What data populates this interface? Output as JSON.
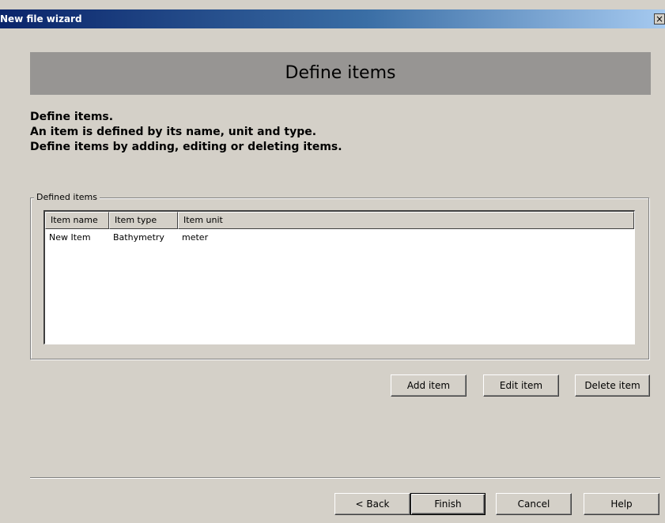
{
  "window": {
    "title": "New file wizard",
    "close_glyph": "×"
  },
  "header": {
    "title": "Define items"
  },
  "description": {
    "line1": "Define items.",
    "line2": "An item is defined by its name, unit and type.",
    "line3": "Define items by adding, editing or deleting items."
  },
  "group": {
    "label": "Defined items"
  },
  "table": {
    "columns": [
      "Item name",
      "Item type",
      "Item unit"
    ],
    "rows": [
      [
        "New Item",
        "Bathymetry",
        "meter"
      ]
    ]
  },
  "item_buttons": {
    "add": "Add item",
    "edit": "Edit item",
    "delete": "Delete item"
  },
  "nav_buttons": {
    "back": "< Back",
    "finish": "Finish",
    "cancel": "Cancel",
    "help": "Help"
  }
}
